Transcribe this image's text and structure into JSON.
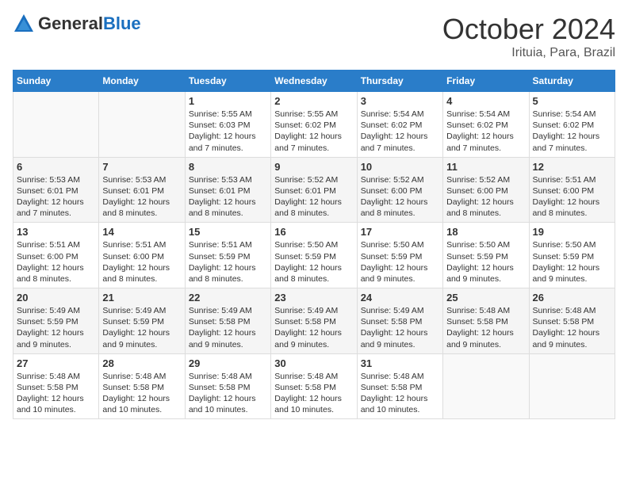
{
  "header": {
    "logo_general": "General",
    "logo_blue": "Blue",
    "month": "October 2024",
    "location": "Irituia, Para, Brazil"
  },
  "days_of_week": [
    "Sunday",
    "Monday",
    "Tuesday",
    "Wednesday",
    "Thursday",
    "Friday",
    "Saturday"
  ],
  "weeks": [
    [
      {
        "day": "",
        "info": ""
      },
      {
        "day": "",
        "info": ""
      },
      {
        "day": "1",
        "info": "Sunrise: 5:55 AM\nSunset: 6:03 PM\nDaylight: 12 hours\nand 7 minutes."
      },
      {
        "day": "2",
        "info": "Sunrise: 5:55 AM\nSunset: 6:02 PM\nDaylight: 12 hours\nand 7 minutes."
      },
      {
        "day": "3",
        "info": "Sunrise: 5:54 AM\nSunset: 6:02 PM\nDaylight: 12 hours\nand 7 minutes."
      },
      {
        "day": "4",
        "info": "Sunrise: 5:54 AM\nSunset: 6:02 PM\nDaylight: 12 hours\nand 7 minutes."
      },
      {
        "day": "5",
        "info": "Sunrise: 5:54 AM\nSunset: 6:02 PM\nDaylight: 12 hours\nand 7 minutes."
      }
    ],
    [
      {
        "day": "6",
        "info": "Sunrise: 5:53 AM\nSunset: 6:01 PM\nDaylight: 12 hours\nand 7 minutes."
      },
      {
        "day": "7",
        "info": "Sunrise: 5:53 AM\nSunset: 6:01 PM\nDaylight: 12 hours\nand 8 minutes."
      },
      {
        "day": "8",
        "info": "Sunrise: 5:53 AM\nSunset: 6:01 PM\nDaylight: 12 hours\nand 8 minutes."
      },
      {
        "day": "9",
        "info": "Sunrise: 5:52 AM\nSunset: 6:01 PM\nDaylight: 12 hours\nand 8 minutes."
      },
      {
        "day": "10",
        "info": "Sunrise: 5:52 AM\nSunset: 6:00 PM\nDaylight: 12 hours\nand 8 minutes."
      },
      {
        "day": "11",
        "info": "Sunrise: 5:52 AM\nSunset: 6:00 PM\nDaylight: 12 hours\nand 8 minutes."
      },
      {
        "day": "12",
        "info": "Sunrise: 5:51 AM\nSunset: 6:00 PM\nDaylight: 12 hours\nand 8 minutes."
      }
    ],
    [
      {
        "day": "13",
        "info": "Sunrise: 5:51 AM\nSunset: 6:00 PM\nDaylight: 12 hours\nand 8 minutes."
      },
      {
        "day": "14",
        "info": "Sunrise: 5:51 AM\nSunset: 6:00 PM\nDaylight: 12 hours\nand 8 minutes."
      },
      {
        "day": "15",
        "info": "Sunrise: 5:51 AM\nSunset: 5:59 PM\nDaylight: 12 hours\nand 8 minutes."
      },
      {
        "day": "16",
        "info": "Sunrise: 5:50 AM\nSunset: 5:59 PM\nDaylight: 12 hours\nand 8 minutes."
      },
      {
        "day": "17",
        "info": "Sunrise: 5:50 AM\nSunset: 5:59 PM\nDaylight: 12 hours\nand 9 minutes."
      },
      {
        "day": "18",
        "info": "Sunrise: 5:50 AM\nSunset: 5:59 PM\nDaylight: 12 hours\nand 9 minutes."
      },
      {
        "day": "19",
        "info": "Sunrise: 5:50 AM\nSunset: 5:59 PM\nDaylight: 12 hours\nand 9 minutes."
      }
    ],
    [
      {
        "day": "20",
        "info": "Sunrise: 5:49 AM\nSunset: 5:59 PM\nDaylight: 12 hours\nand 9 minutes."
      },
      {
        "day": "21",
        "info": "Sunrise: 5:49 AM\nSunset: 5:59 PM\nDaylight: 12 hours\nand 9 minutes."
      },
      {
        "day": "22",
        "info": "Sunrise: 5:49 AM\nSunset: 5:58 PM\nDaylight: 12 hours\nand 9 minutes."
      },
      {
        "day": "23",
        "info": "Sunrise: 5:49 AM\nSunset: 5:58 PM\nDaylight: 12 hours\nand 9 minutes."
      },
      {
        "day": "24",
        "info": "Sunrise: 5:49 AM\nSunset: 5:58 PM\nDaylight: 12 hours\nand 9 minutes."
      },
      {
        "day": "25",
        "info": "Sunrise: 5:48 AM\nSunset: 5:58 PM\nDaylight: 12 hours\nand 9 minutes."
      },
      {
        "day": "26",
        "info": "Sunrise: 5:48 AM\nSunset: 5:58 PM\nDaylight: 12 hours\nand 9 minutes."
      }
    ],
    [
      {
        "day": "27",
        "info": "Sunrise: 5:48 AM\nSunset: 5:58 PM\nDaylight: 12 hours\nand 10 minutes."
      },
      {
        "day": "28",
        "info": "Sunrise: 5:48 AM\nSunset: 5:58 PM\nDaylight: 12 hours\nand 10 minutes."
      },
      {
        "day": "29",
        "info": "Sunrise: 5:48 AM\nSunset: 5:58 PM\nDaylight: 12 hours\nand 10 minutes."
      },
      {
        "day": "30",
        "info": "Sunrise: 5:48 AM\nSunset: 5:58 PM\nDaylight: 12 hours\nand 10 minutes."
      },
      {
        "day": "31",
        "info": "Sunrise: 5:48 AM\nSunset: 5:58 PM\nDaylight: 12 hours\nand 10 minutes."
      },
      {
        "day": "",
        "info": ""
      },
      {
        "day": "",
        "info": ""
      }
    ]
  ]
}
